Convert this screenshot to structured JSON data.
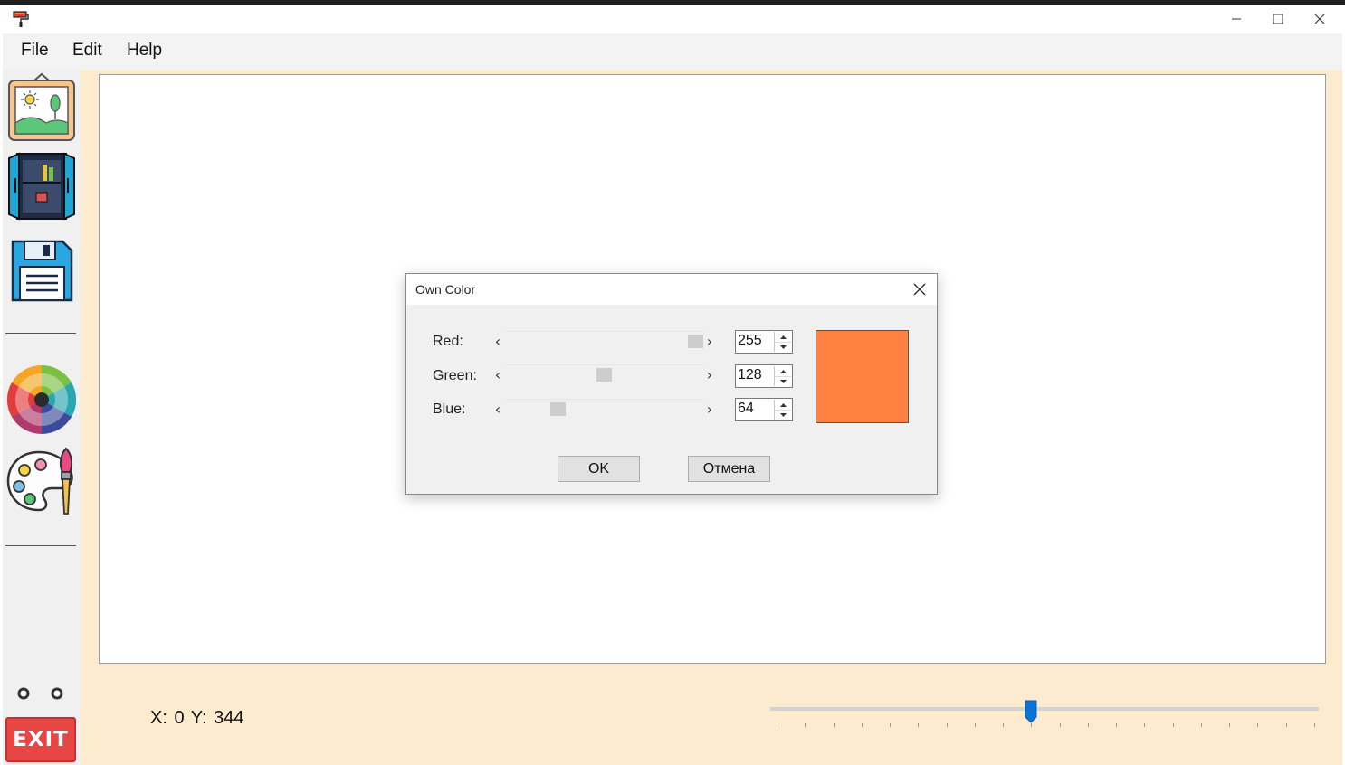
{
  "window": {
    "icon": "paint-roller-icon",
    "controls": [
      "minimize-icon",
      "maximize-icon",
      "close-icon"
    ]
  },
  "menu": {
    "items": [
      "File",
      "Edit",
      "Help"
    ]
  },
  "toolbar": {
    "tools": [
      "picture-frame-icon",
      "wardrobe-icon",
      "floppy-save-icon",
      "color-wheel-icon",
      "palette-brush-icon"
    ],
    "exit_label": "EXIT"
  },
  "status": {
    "coords": "X: 0  Y: 344",
    "zoom_slider": {
      "min": 0,
      "max": 19,
      "value": 9
    }
  },
  "dialog": {
    "title": "Own Color",
    "channels": [
      {
        "label": "Red:",
        "value": 255,
        "max": 255
      },
      {
        "label": "Green:",
        "value": 128,
        "max": 255
      },
      {
        "label": "Blue:",
        "value": 64,
        "max": 255
      }
    ],
    "preview_color": "#ff8040",
    "ok_label": "OK",
    "cancel_label": "Отмена"
  },
  "colors": {
    "work_area": "#fdebd0",
    "exit_button": "#e84545",
    "slider_thumb": "#0a74d6"
  }
}
